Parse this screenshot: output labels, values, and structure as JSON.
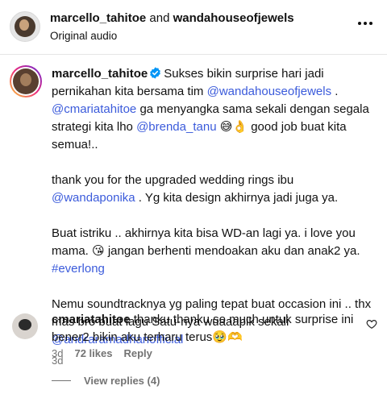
{
  "header": {
    "author": "marcello_tahitoe",
    "joiner": " and ",
    "collaborator": "wandahouseofjewels",
    "audio": "Original audio"
  },
  "post": {
    "username": "marcello_tahitoe",
    "p1": {
      "t1": "Sukses bikin surprise hari jadi pernikahan kita bersama tim ",
      "m1": "@wandahouseofjewels",
      "t2": " . ",
      "m2": "@cmariatahitoe",
      "t3": " ga menyangka sama sekali dengan segala strategi kita lho ",
      "m3": "@brenda_tanu",
      "t4": " 😅👌 good job buat kita semua!.."
    },
    "p2": {
      "t1": "thank you for the upgraded wedding rings ibu ",
      "m1": "@wandaponika",
      "t2": " . Yg kita design akhirnya jadi juga ya."
    },
    "p3": {
      "t1": "Buat istriku .. akhirnya kita bisa WD-an lagi ya. i love you mama. 😘 jangan berhenti mendoakan aku dan anak2 ya. ",
      "h1": "#everlong"
    },
    "p4": {
      "t1": "Nemu soundtracknya yg paling tepat buat occasion ini .. thx mas bro buat lagu Satu-nya wuaaapik sekali ",
      "m1": "@andraramadhanofficial"
    },
    "time": "3d"
  },
  "comment": {
    "username": "cmariatahitoe",
    "text": " thanku thanku so much untuk surprise ini bener2 bikin aku terharu terus🥹🫶",
    "time": "3d",
    "likes": "72 likes",
    "reply": "Reply",
    "view_replies": "View replies (4)"
  }
}
